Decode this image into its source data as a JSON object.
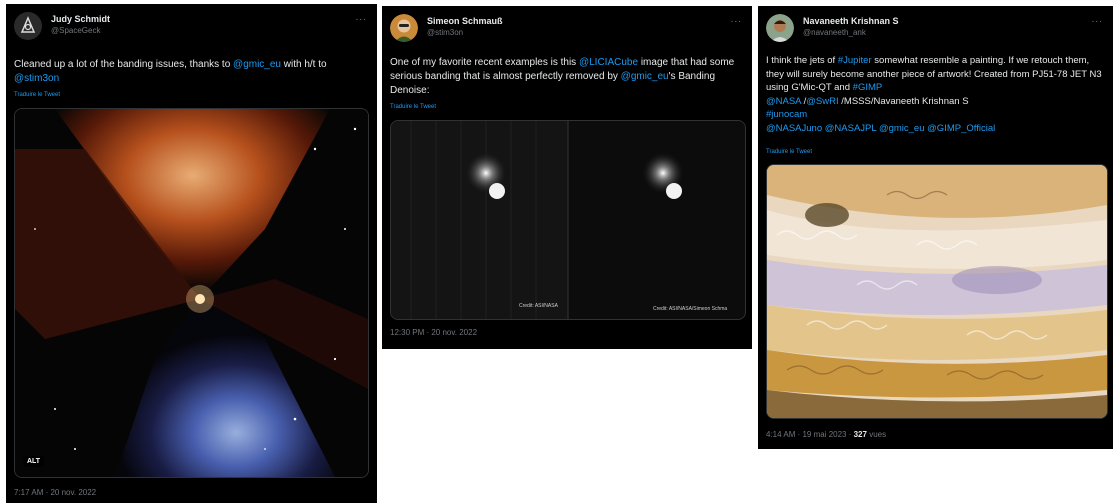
{
  "tweets": [
    {
      "name": "Judy Schmidt",
      "handle": "@SpaceGeck",
      "text_before": "Cleaned up a lot of the banding issues, thanks to ",
      "mention1": "@gmic_eu",
      "text_mid": " with h/t to ",
      "mention2": "@stim3on",
      "translate": "Traduire le Tweet",
      "alt_badge": "ALT",
      "time": "7:17 AM · 20 nov. 2022"
    },
    {
      "name": "Simeon Schmauß",
      "handle": "@stim3on",
      "text_before": "One of my favorite recent examples is this ",
      "mention1": "@LICIACube",
      "text_mid": " image that had some serious banding that is almost perfectly removed by ",
      "mention2": "@gmic_eu",
      "text_after": "'s Banding Denoise:",
      "translate": "Traduire le Tweet",
      "credit_left": "Credit: ASI/NASA",
      "credit_right": "Credit: ASI/NASA/Simeon Schma",
      "time": "12:30 PM · 20 nov. 2022"
    },
    {
      "name": "Navaneeth Krishnan S",
      "handle": "@navaneeth_ank",
      "text_a": "I think the jets of ",
      "hashtag_jupiter": "#Jupiter",
      "text_b": " somewhat resemble a painting. If we retouch them, they will surely become another piece of artwork! Created from PJ51-78 JET N3 using G'Mic-QT and ",
      "hashtag_gimp": "#GIMP",
      "mention_nasa": "@NASA",
      "slash1": " /",
      "mention_swri": "@SwRI",
      "text_c": " /MSSS/Navaneeth Krishnan S",
      "hashtag_junocam": "#junocam",
      "mention_nasajuno": "@NASAJuno",
      "mention_nasajpl": "@NASAJPL",
      "mention_gmic": "@gmic_eu",
      "mention_gimp_official": "@GIMP_Official",
      "translate": "Traduire le Tweet",
      "time": "4:14 AM · 19 mai 2023 · ",
      "views_count": "327",
      "views_label": " vues"
    }
  ],
  "more_icon": "...",
  "colors": {
    "background": "#000000",
    "text": "#e7e9ea",
    "muted": "#71767b",
    "link": "#1d9bf0"
  }
}
